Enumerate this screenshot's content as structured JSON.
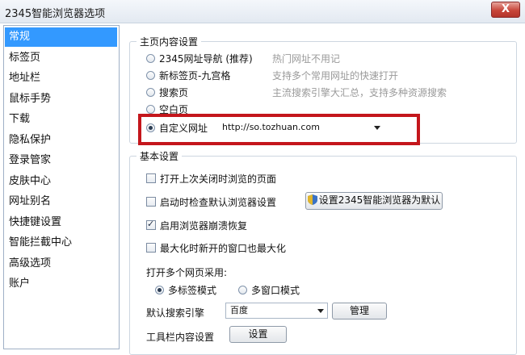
{
  "window": {
    "title": "2345智能浏览器选项",
    "close_symbol": "X"
  },
  "sidebar": {
    "items": [
      {
        "label": "常规",
        "selected": true
      },
      {
        "label": "标签页"
      },
      {
        "label": "地址栏"
      },
      {
        "label": "鼠标手势"
      },
      {
        "label": "下载"
      },
      {
        "label": "隐私保护"
      },
      {
        "label": "登录管家"
      },
      {
        "label": "皮肤中心"
      },
      {
        "label": "网址别名"
      },
      {
        "label": "快捷键设置"
      },
      {
        "label": "智能拦截中心"
      },
      {
        "label": "高级选项"
      },
      {
        "label": "账户"
      }
    ]
  },
  "homepage": {
    "group_label": "主页内容设置",
    "options": [
      {
        "label": "2345网址导航 (推荐)",
        "hint": "热门网址不用记",
        "checked": false
      },
      {
        "label": "新标签页-九宫格",
        "hint": "支持多个常用网址的快速打开",
        "checked": false
      },
      {
        "label": "搜索页",
        "hint": "主流搜索引擎大汇总，支持多种资源搜索",
        "checked": false
      },
      {
        "label": "空白页",
        "hint": "",
        "checked": false
      },
      {
        "label": "自定义网址",
        "hint": "",
        "checked": true
      }
    ],
    "custom_url": "http://so.tozhuan.com"
  },
  "basic": {
    "group_label": "基本设置",
    "checkboxes": [
      {
        "label": "打开上次关闭时浏览的页面",
        "checked": false
      },
      {
        "label": "启动时检查默认浏览器设置",
        "checked": false
      },
      {
        "label": "启用浏览器崩溃恢复",
        "checked": true
      },
      {
        "label": "最大化时新开的窗口也最大化",
        "checked": false
      }
    ],
    "set_default_label": "设置2345智能浏览器为默认",
    "open_pages_label": "打开多个网页采用:",
    "open_modes": [
      {
        "label": "多标签模式",
        "checked": true
      },
      {
        "label": "多窗口模式",
        "checked": false
      }
    ],
    "search_engine_label": "默认搜索引擎",
    "search_engine_value": "百度",
    "manage_label": "管理",
    "toolbar_label": "工具栏内容设置",
    "toolbar_settings_label": "设置"
  },
  "colors": {
    "selected_bg": "#3399ff",
    "highlight": "#c4161c",
    "hint": "#9a9a9a"
  }
}
